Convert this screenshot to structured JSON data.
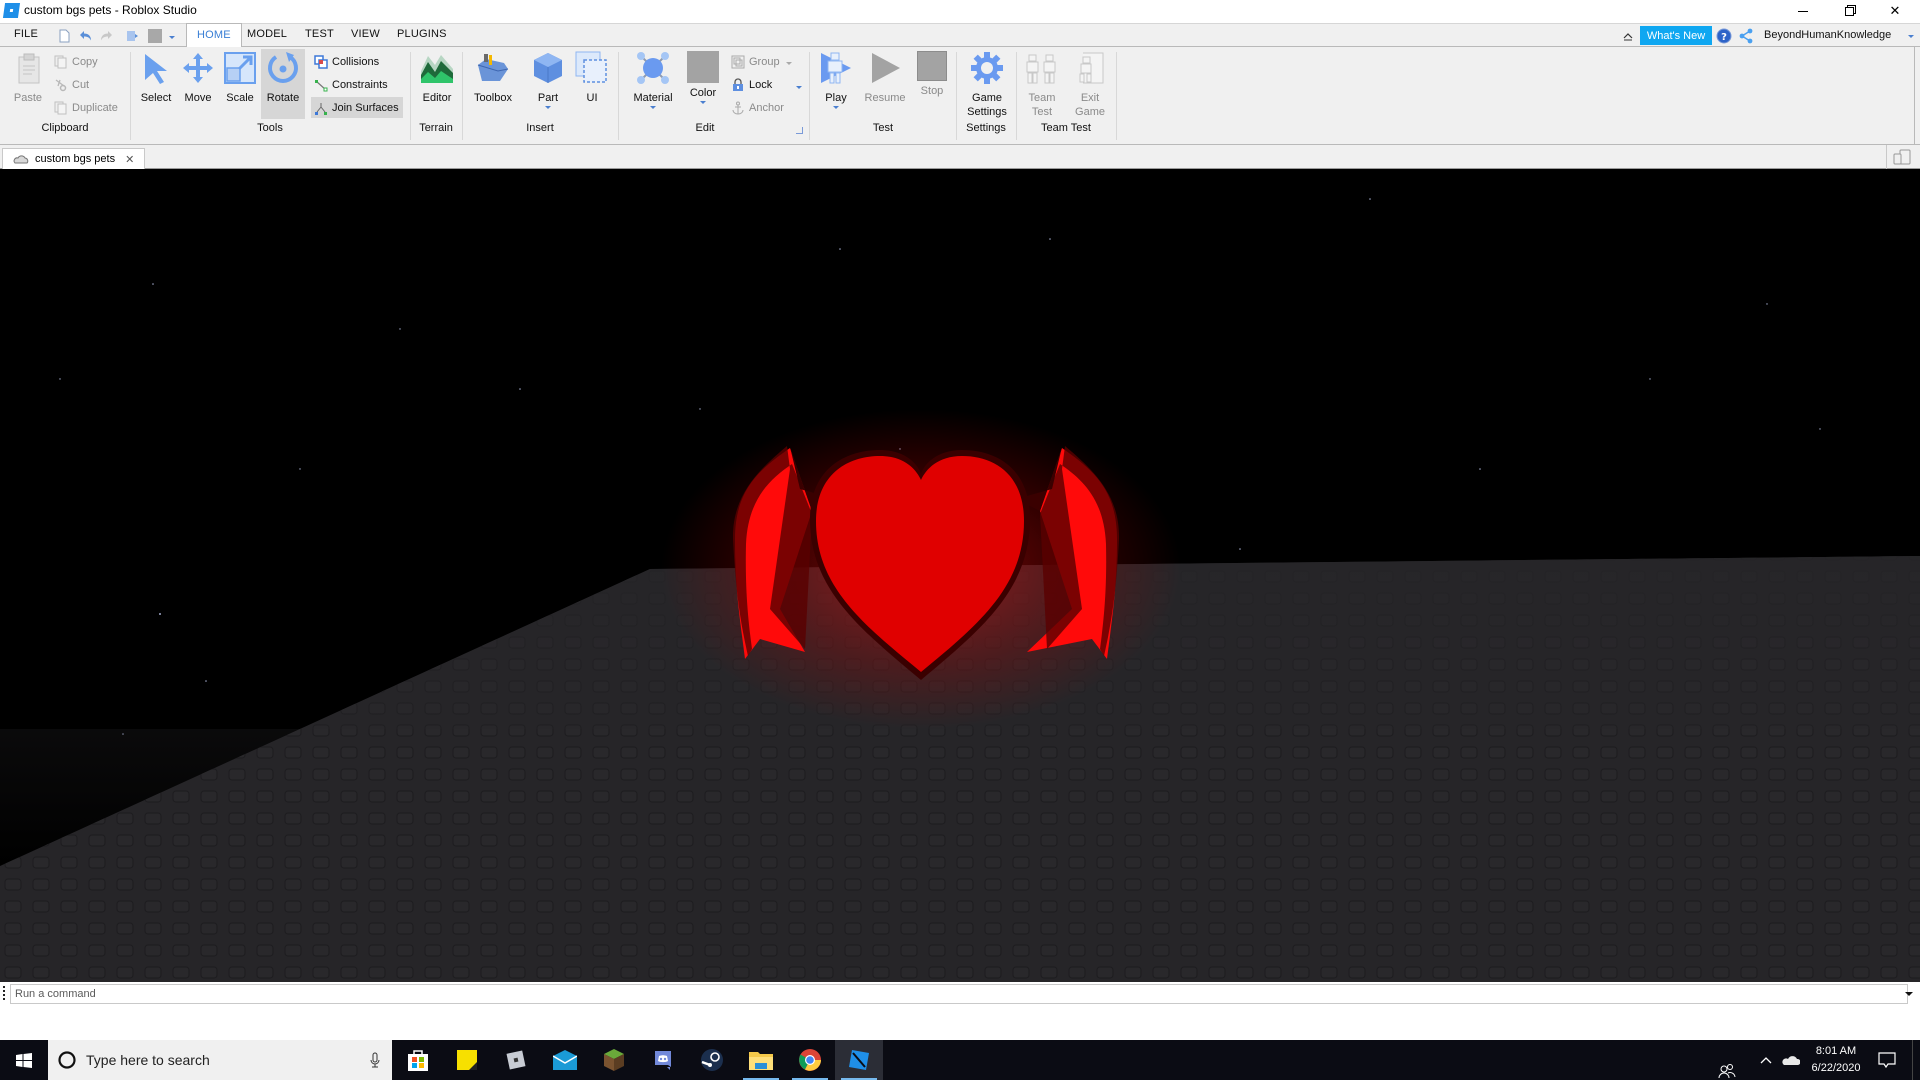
{
  "window": {
    "title": "custom bgs pets - Roblox Studio",
    "controls": {
      "minimize": "—",
      "maximize": "❐",
      "close": "✕"
    }
  },
  "menu": {
    "file_label": "FILE",
    "tabs": [
      "HOME",
      "MODEL",
      "TEST",
      "VIEW",
      "PLUGINS"
    ],
    "active_tab": "HOME",
    "whats_new": "What's New",
    "username": "BeyondHumanKnowledge"
  },
  "ribbon": {
    "clipboard": {
      "label": "Clipboard",
      "paste": "Paste",
      "copy": "Copy",
      "cut": "Cut",
      "duplicate": "Duplicate"
    },
    "tools": {
      "label": "Tools",
      "select": "Select",
      "move": "Move",
      "scale": "Scale",
      "rotate": "Rotate",
      "collisions": "Collisions",
      "constraints": "Constraints",
      "join_surfaces": "Join Surfaces"
    },
    "terrain": {
      "label": "Terrain",
      "editor": "Editor"
    },
    "insert": {
      "label": "Insert",
      "toolbox": "Toolbox",
      "part": "Part",
      "ui": "UI"
    },
    "edit": {
      "label": "Edit",
      "material": "Material",
      "color": "Color",
      "group": "Group",
      "lock": "Lock",
      "anchor": "Anchor"
    },
    "test": {
      "label": "Test",
      "play": "Play",
      "resume": "Resume",
      "stop": "Stop"
    },
    "settings": {
      "label": "Settings",
      "game_settings_1": "Game",
      "game_settings_2": "Settings"
    },
    "team_test": {
      "label": "Team Test",
      "team_test_1": "Team",
      "team_test_2": "Test",
      "exit_game_1": "Exit",
      "exit_game_2": "Game"
    }
  },
  "document": {
    "tab_label": "custom bgs pets",
    "close": "✕"
  },
  "viewport": {
    "scene": "Baseplate with red heart pet with devil wings",
    "heart_color": "#e00000",
    "sky_color": "#000000",
    "baseplate_color": "#262528"
  },
  "command_bar": {
    "placeholder": "Run a command"
  },
  "taskbar": {
    "search_placeholder": "Type here to search",
    "apps": [
      "Microsoft Store",
      "Sticky Notes",
      "Roblox",
      "Mail",
      "Minecraft",
      "Discord",
      "Steam",
      "File Explorer",
      "Google Chrome",
      "Roblox Studio"
    ],
    "time": "8:01 AM",
    "date": "6/22/2020"
  }
}
